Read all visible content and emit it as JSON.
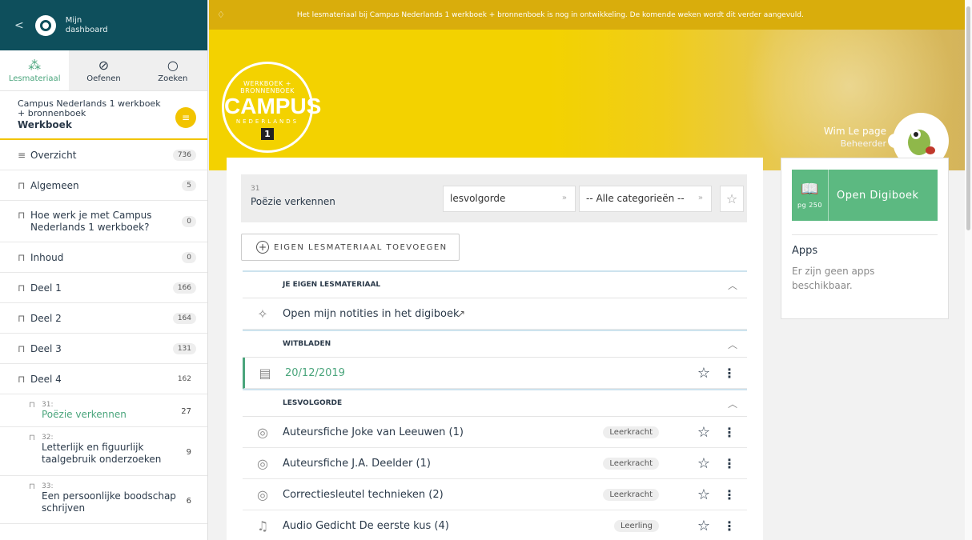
{
  "sidebar": {
    "back": "<",
    "dashboard_label": "Mijn dashboard",
    "tabs": [
      {
        "label": "Lesmateriaal",
        "icon": "nodes-icon"
      },
      {
        "label": "Oefenen",
        "icon": "check-icon"
      },
      {
        "label": "Zoeken",
        "icon": "search-icon"
      }
    ],
    "book_title": "Campus Nederlands 1 werkboek + bronnenboek",
    "book_subtitle": "Werkboek",
    "items": [
      {
        "label": "Overzicht",
        "count": "736"
      },
      {
        "label": "Algemeen",
        "count": "5"
      },
      {
        "label": "Hoe werk je met Campus Nederlands 1 werkboek?",
        "count": "0"
      },
      {
        "label": "Inhoud",
        "count": "0"
      },
      {
        "label": "Deel 1",
        "count": "166"
      },
      {
        "label": "Deel 2",
        "count": "164"
      },
      {
        "label": "Deel 3",
        "count": "131"
      },
      {
        "label": "Deel 4",
        "count": "162"
      }
    ],
    "subitems": [
      {
        "num": "31:",
        "label": "Poëzie verkennen",
        "count": "27"
      },
      {
        "num": "32:",
        "label": "Letterlijk en figuurlijk taalgebruik onderzoeken",
        "count": "9"
      },
      {
        "num": "33:",
        "label": "Een persoonlijke boodschap schrijven",
        "count": "6"
      }
    ]
  },
  "notice": "Het lesmateriaal bij Campus Nederlands 1 werkboek + bronnenboek is nog in ontwikkeling. De komende weken wordt dit verder aangevuld.",
  "logo": {
    "line1": "WERKBOEK + BRONNENBOEK",
    "line2": "CAMPUS",
    "line3": "NEDERLANDS",
    "line4": "1"
  },
  "user": {
    "name": "Wim Le page",
    "role": "Beheerder"
  },
  "lesson": {
    "number": "31",
    "title": "Poëzie verkennen",
    "sort_select": "lesvolgorde",
    "category_select": "-- Alle categorieën --"
  },
  "add_button": "EIGEN LESMATERIAAL TOEVOEGEN",
  "sections": {
    "own": "JE EIGEN LESMATERIAAL",
    "own_row": "Open mijn notities in het digiboek",
    "white": "WITBLADEN",
    "white_row": "20/12/2019",
    "order": "LESVOLGORDE"
  },
  "rows": [
    {
      "title": "Auteursfiche Joke van Leeuwen (1)",
      "tag": "Leerkracht"
    },
    {
      "title": "Auteursfiche J.A. Deelder (1)",
      "tag": "Leerkracht"
    },
    {
      "title": "Correctiesleutel technieken (2)",
      "tag": "Leerkracht"
    },
    {
      "title": "Audio Gedicht De eerste kus (4)",
      "tag": "Leerling"
    }
  ],
  "right_panel": {
    "digibook_label": "Open Digiboek",
    "page": "pg 250",
    "apps_title": "Apps",
    "apps_empty": "Er zijn geen apps beschikbaar."
  },
  "colors": {
    "brand_dark": "#0e4f5c",
    "accent_green": "#5cb981",
    "hero_yellow": "#f3d200",
    "notice": "#d9ad0c"
  }
}
